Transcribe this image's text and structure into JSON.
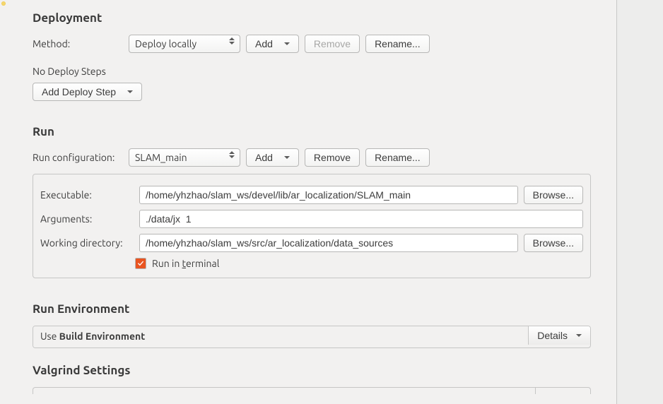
{
  "deployment": {
    "heading": "Deployment",
    "method_label": "Method:",
    "method_value": "Deploy locally",
    "add_btn": "Add",
    "remove_btn": "Remove",
    "rename_btn": "Rename...",
    "no_steps": "No Deploy Steps",
    "add_step_btn": "Add Deploy Step"
  },
  "run": {
    "heading": "Run",
    "config_label": "Run configuration:",
    "config_value": "SLAM_main",
    "add_btn": "Add",
    "remove_btn": "Remove",
    "rename_btn": "Rename...",
    "executable_label": "Executable:",
    "executable_value": "/home/yhzhao/slam_ws/devel/lib/ar_localization/SLAM_main",
    "arguments_label": "Arguments:",
    "arguments_value": "./data/jx  1",
    "workdir_label": "Working directory:",
    "workdir_value": "/home/yhzhao/slam_ws/src/ar_localization/data_sources",
    "browse_btn": "Browse...",
    "run_terminal_prefix": "Run in ",
    "run_terminal_t": "t",
    "run_terminal_suffix": "erminal",
    "run_terminal_checked": true
  },
  "run_env": {
    "heading": "Run Environment",
    "use_prefix": "Use ",
    "use_bold": "Build Environment",
    "details_btn": "Details"
  },
  "valgrind": {
    "heading": "Valgrind Settings"
  }
}
